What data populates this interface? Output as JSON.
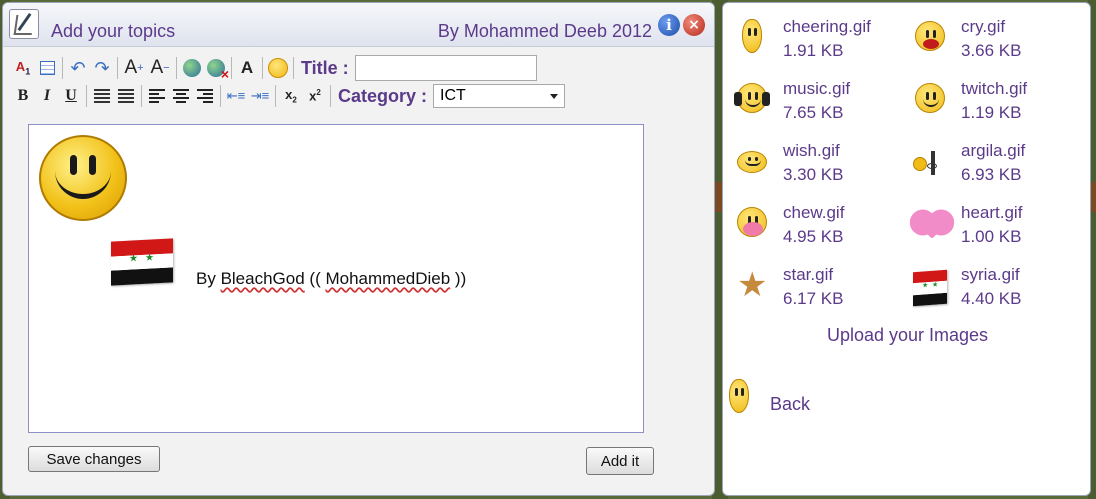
{
  "editor": {
    "title": "Add your topics",
    "credit": "By Mohammed Deeb 2012",
    "info_icon_glyph": "i",
    "close_icon_glyph": "×"
  },
  "toolbar": {
    "title_label": "Title :",
    "title_value": "",
    "category_label": "Category :",
    "category_value": "ICT",
    "font_color_glyph": "A",
    "bold_glyph": "B",
    "italic_glyph": "I",
    "underline_glyph": "U"
  },
  "content": {
    "signature_prefix": "By ",
    "signature_name": "BleachGod",
    "signature_mid": " (( ",
    "signature_author": "MohammedDieb",
    "signature_suffix": " ))"
  },
  "buttons": {
    "save": "Save changes",
    "add": "Add it"
  },
  "files": [
    {
      "name": "cheering.gif",
      "size": "1.91 KB",
      "icon": "cheering-icon"
    },
    {
      "name": "cry.gif",
      "size": "3.66 KB",
      "icon": "cry-icon"
    },
    {
      "name": "music.gif",
      "size": "7.65 KB",
      "icon": "music-icon"
    },
    {
      "name": "twitch.gif",
      "size": "1.19 KB",
      "icon": "twitch-icon"
    },
    {
      "name": "wish.gif",
      "size": "3.30 KB",
      "icon": "wish-icon"
    },
    {
      "name": "argila.gif",
      "size": "6.93 KB",
      "icon": "argila-icon"
    },
    {
      "name": "chew.gif",
      "size": "4.95 KB",
      "icon": "chew-icon"
    },
    {
      "name": "heart.gif",
      "size": "1.00 KB",
      "icon": "heart-icon"
    },
    {
      "name": "star.gif",
      "size": "6.17 KB",
      "icon": "star-icon"
    },
    {
      "name": "syria.gif",
      "size": "4.40 KB",
      "icon": "syria-flag-icon"
    }
  ],
  "panel": {
    "upload_label": "Upload your Images",
    "back_label": "Back"
  },
  "colors": {
    "accent_purple": "#5b3a8a",
    "background_green": "#5a6a3a",
    "editor_border": "#8f8fc8"
  }
}
